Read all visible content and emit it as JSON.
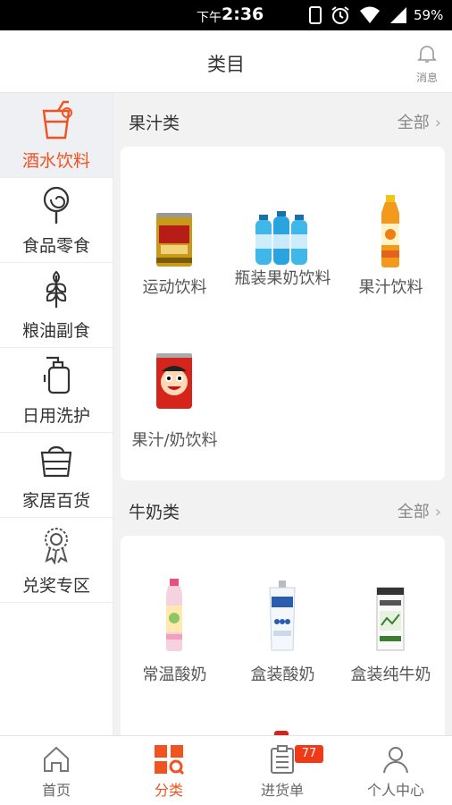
{
  "status_bar": {
    "time_prefix": "下午",
    "time": "2:36",
    "battery": "59%"
  },
  "header": {
    "title": "类目",
    "message_label": "消息"
  },
  "sidebar": {
    "items": [
      {
        "label": "酒水饮料",
        "icon": "cup-icon",
        "active": true
      },
      {
        "label": "食品零食",
        "icon": "lollipop-icon"
      },
      {
        "label": "粮油副食",
        "icon": "wheat-icon"
      },
      {
        "label": "日用洗护",
        "icon": "bottle-icon"
      },
      {
        "label": "家居百货",
        "icon": "basket-icon"
      },
      {
        "label": "兑奖专区",
        "icon": "award-icon"
      }
    ]
  },
  "sections": [
    {
      "title": "果汁类",
      "all_label": "全部",
      "products": [
        {
          "name": "运动饮料",
          "image": "red-bull-can"
        },
        {
          "name": "瓶装果奶饮料",
          "image": "blue-bottles-pack"
        },
        {
          "name": "果汁饮料",
          "image": "orange-juice-bottle"
        },
        {
          "name": "果汁/奶饮料",
          "image": "wangzai-can"
        }
      ]
    },
    {
      "title": "牛奶类",
      "all_label": "全部",
      "products": [
        {
          "name": "常温酸奶",
          "image": "yogurt-bottle"
        },
        {
          "name": "盒装酸奶",
          "image": "yogurt-pouch"
        },
        {
          "name": "盒装纯牛奶",
          "image": "milk-carton"
        }
      ]
    }
  ],
  "bottom_nav": {
    "items": [
      {
        "label": "首页",
        "icon": "home-icon"
      },
      {
        "label": "分类",
        "icon": "category-icon",
        "active": true
      },
      {
        "label": "进货单",
        "icon": "order-list-icon",
        "badge": "77"
      },
      {
        "label": "个人中心",
        "icon": "user-icon"
      }
    ]
  },
  "colors": {
    "accent": "#f25220",
    "badge": "#f03a17"
  }
}
